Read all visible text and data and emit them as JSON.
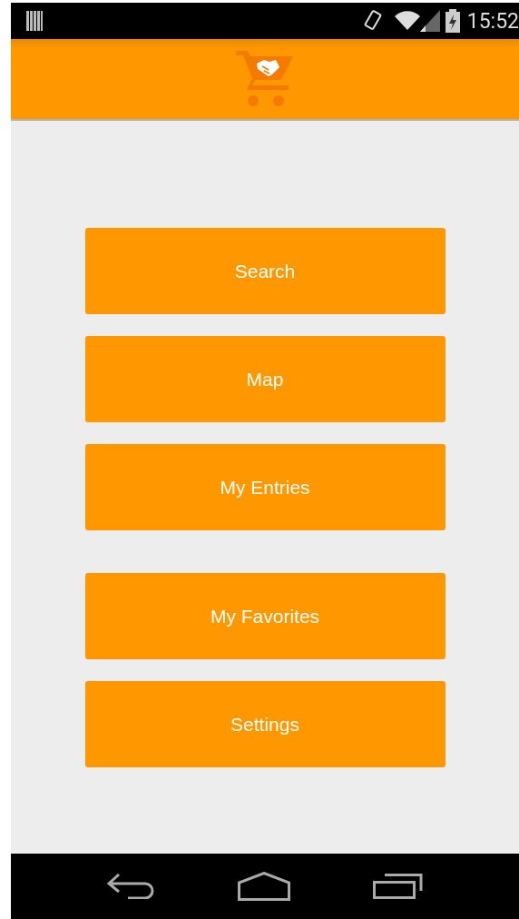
{
  "status_bar": {
    "time": "15:52"
  },
  "menu_groups": [
    {
      "buttons": [
        {
          "label": "Search"
        },
        {
          "label": "Map"
        },
        {
          "label": "My Entries"
        }
      ]
    },
    {
      "buttons": [
        {
          "label": "My Favorites"
        },
        {
          "label": "Settings"
        }
      ]
    }
  ]
}
